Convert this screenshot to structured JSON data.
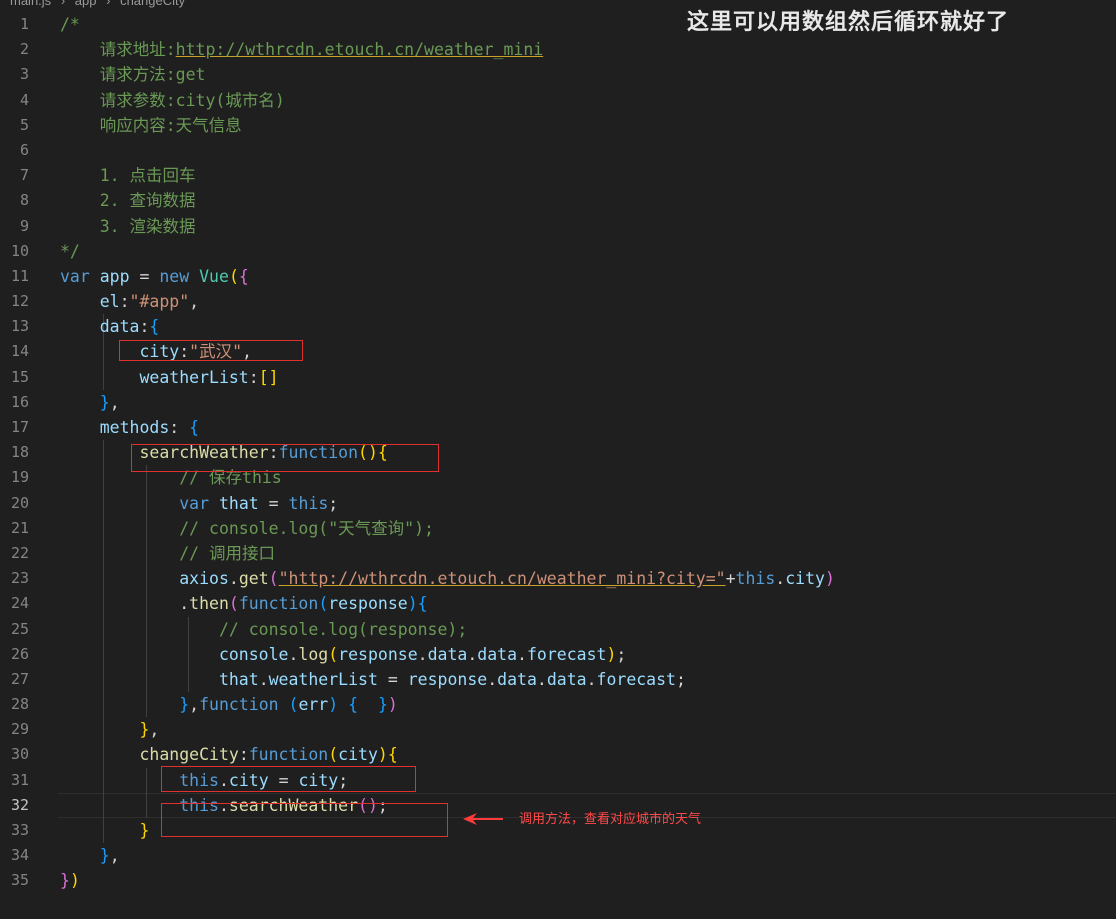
{
  "breadcrumb": [
    "main.js",
    "app",
    "changeCity"
  ],
  "overlay_title": "这里可以用数组然后循环就好了",
  "note": "调用方法，查看对应城市的天气",
  "lines": [
    {
      "n": "1",
      "tokens": [
        [
          "/*",
          "c-comment"
        ]
      ]
    },
    {
      "n": "2",
      "tokens": [
        [
          "    请求地址:",
          "c-comment"
        ],
        [
          "http://wthrcdn.etouch.cn/weather_mini",
          "c-comment u"
        ]
      ]
    },
    {
      "n": "3",
      "tokens": [
        [
          "    请求方法:get",
          "c-comment"
        ]
      ]
    },
    {
      "n": "4",
      "tokens": [
        [
          "    请求参数:city(城市名)",
          "c-comment"
        ]
      ]
    },
    {
      "n": "5",
      "tokens": [
        [
          "    响应内容:天气信息",
          "c-comment"
        ]
      ]
    },
    {
      "n": "6",
      "tokens": []
    },
    {
      "n": "7",
      "tokens": [
        [
          "    1. 点击回车",
          "c-comment"
        ]
      ]
    },
    {
      "n": "8",
      "tokens": [
        [
          "    2. 查询数据",
          "c-comment"
        ]
      ]
    },
    {
      "n": "9",
      "tokens": [
        [
          "    3. 渲染数据",
          "c-comment"
        ]
      ]
    },
    {
      "n": "10",
      "tokens": [
        [
          "*/",
          "c-comment"
        ]
      ]
    },
    {
      "n": "11",
      "tokens": [
        [
          "var ",
          "c-kw"
        ],
        [
          "app",
          "c-var"
        ],
        [
          " = ",
          "c-op"
        ],
        [
          "new ",
          "c-kw"
        ],
        [
          "Vue",
          "c-cls"
        ],
        [
          "(",
          "c-br1"
        ],
        [
          "{",
          "c-br2"
        ]
      ]
    },
    {
      "n": "12",
      "tokens": [
        [
          "    el",
          "c-var"
        ],
        [
          ":",
          "c-op"
        ],
        [
          "\"#app\"",
          "c-str"
        ],
        [
          ",",
          "c-op"
        ]
      ]
    },
    {
      "n": "13",
      "tokens": [
        [
          "    data",
          "c-var"
        ],
        [
          ":",
          "c-op"
        ],
        [
          "{",
          "c-br3"
        ]
      ]
    },
    {
      "n": "14",
      "tokens": [
        [
          "        city",
          "c-var"
        ],
        [
          ":",
          "c-op"
        ],
        [
          "\"武汉\"",
          "c-str"
        ],
        [
          ",",
          "c-op"
        ]
      ]
    },
    {
      "n": "15",
      "tokens": [
        [
          "        weatherList",
          "c-var"
        ],
        [
          ":",
          "c-op"
        ],
        [
          "[]",
          "c-br1"
        ]
      ]
    },
    {
      "n": "16",
      "tokens": [
        [
          "    ",
          "c-op"
        ],
        [
          "}",
          "c-br3"
        ],
        [
          ",",
          "c-op"
        ]
      ]
    },
    {
      "n": "17",
      "tokens": [
        [
          "    methods",
          "c-var"
        ],
        [
          ": ",
          "c-op"
        ],
        [
          "{",
          "c-br3"
        ]
      ]
    },
    {
      "n": "18",
      "tokens": [
        [
          "        searchWeather",
          "c-fn"
        ],
        [
          ":",
          "c-op"
        ],
        [
          "function",
          "c-kw"
        ],
        [
          "()",
          "c-br1"
        ],
        [
          "{",
          "c-br1"
        ]
      ]
    },
    {
      "n": "19",
      "tokens": [
        [
          "            // 保存this",
          "c-comment"
        ]
      ]
    },
    {
      "n": "20",
      "tokens": [
        [
          "            var ",
          "c-kw"
        ],
        [
          "that",
          "c-var"
        ],
        [
          " = ",
          "c-op"
        ],
        [
          "this",
          "c-kw"
        ],
        [
          ";",
          "c-op"
        ]
      ]
    },
    {
      "n": "21",
      "tokens": [
        [
          "            // console.log(\"天气查询\");",
          "c-comment"
        ]
      ]
    },
    {
      "n": "22",
      "tokens": [
        [
          "            // 调用接口",
          "c-comment"
        ]
      ]
    },
    {
      "n": "23",
      "tokens": [
        [
          "            axios",
          "c-var"
        ],
        [
          ".",
          "c-op"
        ],
        [
          "get",
          "c-fn"
        ],
        [
          "(",
          "c-br2"
        ],
        [
          "\"http://wthrcdn.etouch.cn/weather_mini?city=\"",
          "c-str u"
        ],
        [
          "+",
          "c-op"
        ],
        [
          "this",
          "c-kw"
        ],
        [
          ".",
          "c-op"
        ],
        [
          "city",
          "c-var"
        ],
        [
          ")",
          "c-br2"
        ]
      ]
    },
    {
      "n": "24",
      "tokens": [
        [
          "            .",
          "c-op"
        ],
        [
          "then",
          "c-fn"
        ],
        [
          "(",
          "c-br2"
        ],
        [
          "function",
          "c-kw"
        ],
        [
          "(",
          "c-br3"
        ],
        [
          "response",
          "c-var"
        ],
        [
          ")",
          "c-br3"
        ],
        [
          "{",
          "c-br3"
        ]
      ]
    },
    {
      "n": "25",
      "tokens": [
        [
          "                // console.log(response);",
          "c-comment"
        ]
      ]
    },
    {
      "n": "26",
      "tokens": [
        [
          "                console",
          "c-var"
        ],
        [
          ".",
          "c-op"
        ],
        [
          "log",
          "c-fn"
        ],
        [
          "(",
          "c-br1"
        ],
        [
          "response",
          "c-var"
        ],
        [
          ".",
          "c-op"
        ],
        [
          "data",
          "c-var"
        ],
        [
          ".",
          "c-op"
        ],
        [
          "data",
          "c-var"
        ],
        [
          ".",
          "c-op"
        ],
        [
          "forecast",
          "c-var"
        ],
        [
          ")",
          "c-br1"
        ],
        [
          ";",
          "c-op"
        ]
      ]
    },
    {
      "n": "27",
      "tokens": [
        [
          "                that",
          "c-var"
        ],
        [
          ".",
          "c-op"
        ],
        [
          "weatherList",
          "c-var"
        ],
        [
          " = ",
          "c-op"
        ],
        [
          "response",
          "c-var"
        ],
        [
          ".",
          "c-op"
        ],
        [
          "data",
          "c-var"
        ],
        [
          ".",
          "c-op"
        ],
        [
          "data",
          "c-var"
        ],
        [
          ".",
          "c-op"
        ],
        [
          "forecast",
          "c-var"
        ],
        [
          ";",
          "c-op"
        ]
      ]
    },
    {
      "n": "28",
      "tokens": [
        [
          "            ",
          "c-op"
        ],
        [
          "}",
          "c-br3"
        ],
        [
          ",",
          "c-op"
        ],
        [
          "function ",
          "c-kw"
        ],
        [
          "(",
          "c-br3"
        ],
        [
          "err",
          "c-var"
        ],
        [
          ") ",
          "c-br3"
        ],
        [
          "{  ",
          "c-br3"
        ],
        [
          "}",
          "c-br3"
        ],
        [
          ")",
          "c-br2"
        ]
      ]
    },
    {
      "n": "29",
      "tokens": [
        [
          "        ",
          "c-op"
        ],
        [
          "}",
          "c-br1"
        ],
        [
          ",",
          "c-op"
        ]
      ]
    },
    {
      "n": "30",
      "tokens": [
        [
          "        changeCity",
          "c-fn"
        ],
        [
          ":",
          "c-op"
        ],
        [
          "function",
          "c-kw"
        ],
        [
          "(",
          "c-br1"
        ],
        [
          "city",
          "c-var"
        ],
        [
          ")",
          "c-br1"
        ],
        [
          "{",
          "c-br1"
        ]
      ]
    },
    {
      "n": "31",
      "tokens": [
        [
          "            this",
          "c-kw"
        ],
        [
          ".",
          "c-op"
        ],
        [
          "city",
          "c-var"
        ],
        [
          " = ",
          "c-op"
        ],
        [
          "city",
          "c-var"
        ],
        [
          ";",
          "c-op"
        ]
      ]
    },
    {
      "n": "32",
      "tokens": [
        [
          "            this",
          "c-kw"
        ],
        [
          ".",
          "c-op"
        ],
        [
          "searchWeather",
          "c-fn"
        ],
        [
          "()",
          "c-br2"
        ],
        [
          ";",
          "c-op"
        ]
      ]
    },
    {
      "n": "33",
      "tokens": [
        [
          "        ",
          "c-op"
        ],
        [
          "}",
          "c-br1"
        ]
      ]
    },
    {
      "n": "34",
      "tokens": [
        [
          "    ",
          "c-op"
        ],
        [
          "}",
          "c-br3"
        ],
        [
          ",",
          "c-op"
        ]
      ]
    },
    {
      "n": "35",
      "tokens": [
        [
          "}",
          "c-br2"
        ],
        [
          ")",
          "c-br1"
        ]
      ]
    }
  ]
}
